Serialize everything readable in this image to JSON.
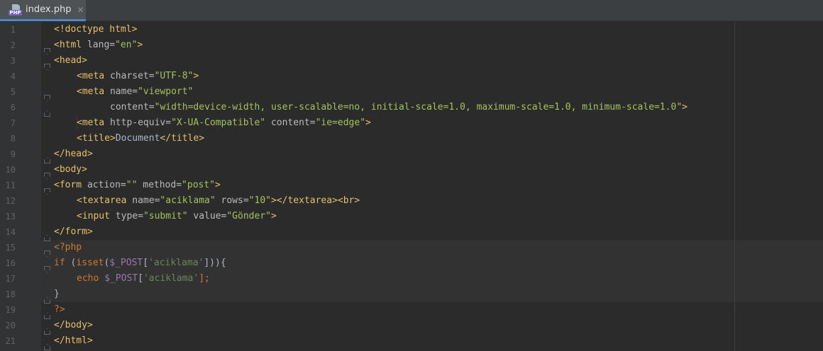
{
  "tab": {
    "label": "index.php",
    "icon": "php-file-icon",
    "close": "✕",
    "badge": "PHP"
  },
  "lines": [
    {
      "n": "1"
    },
    {
      "n": "2"
    },
    {
      "n": "3"
    },
    {
      "n": "4"
    },
    {
      "n": "5"
    },
    {
      "n": "6"
    },
    {
      "n": "7"
    },
    {
      "n": "8"
    },
    {
      "n": "9"
    },
    {
      "n": "10"
    },
    {
      "n": "11"
    },
    {
      "n": "12"
    },
    {
      "n": "13"
    },
    {
      "n": "14"
    },
    {
      "n": "15"
    },
    {
      "n": "16"
    },
    {
      "n": "17"
    },
    {
      "n": "18"
    },
    {
      "n": "19"
    },
    {
      "n": "20"
    },
    {
      "n": "21"
    }
  ],
  "code": {
    "l1": [
      "<!doctype html>"
    ],
    "l2": [
      "<html",
      " lang=",
      "\"en\"",
      ">"
    ],
    "l3": [
      "<head>"
    ],
    "l4": [
      "<meta",
      " charset=",
      "\"UTF-8\"",
      ">"
    ],
    "l5": [
      "<meta",
      " name=",
      "\"viewport\""
    ],
    "l6": [
      "content=",
      "\"width=device-width, user-scalable=no, initial-scale=1.0, maximum-scale=1.0, minimum-scale=1.0\"",
      ">"
    ],
    "l7": [
      "<meta",
      " http-equiv=",
      "\"X-UA-Compatible\"",
      " content=",
      "\"ie=edge\"",
      ">"
    ],
    "l8": [
      "<title>",
      "Document",
      "</title>"
    ],
    "l9": [
      "</head>"
    ],
    "l10": [
      "<body>"
    ],
    "l11": [
      "<form",
      " action=",
      "\"\"",
      " method=",
      "\"post\"",
      ">"
    ],
    "l12": [
      "<textarea",
      " name=",
      "\"aciklama\"",
      " rows=",
      "\"10\"",
      "></textarea><br>"
    ],
    "l13": [
      "<input",
      " type=",
      "\"submit\"",
      " value=",
      "\"Gönder\"",
      ">"
    ],
    "l14": [
      "</form>"
    ],
    "l15": [
      "<?php"
    ],
    "l16": [
      "if",
      " (",
      "isset",
      "(",
      "$_POST",
      "[",
      "'aciklama'",
      "])){"
    ],
    "l17": [
      "echo",
      " ",
      "$_POST",
      "[",
      "'aciklama'",
      "];"
    ],
    "l18": [
      "}"
    ],
    "l19": [
      "?>"
    ],
    "l20": [
      "</body>"
    ],
    "l21": [
      "</html>"
    ]
  }
}
